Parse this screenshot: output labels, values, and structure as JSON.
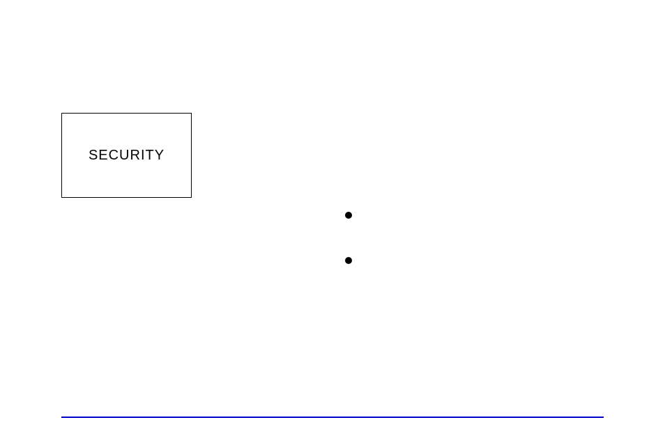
{
  "box": {
    "label": "SECURITY"
  },
  "bullets": [
    "",
    ""
  ]
}
